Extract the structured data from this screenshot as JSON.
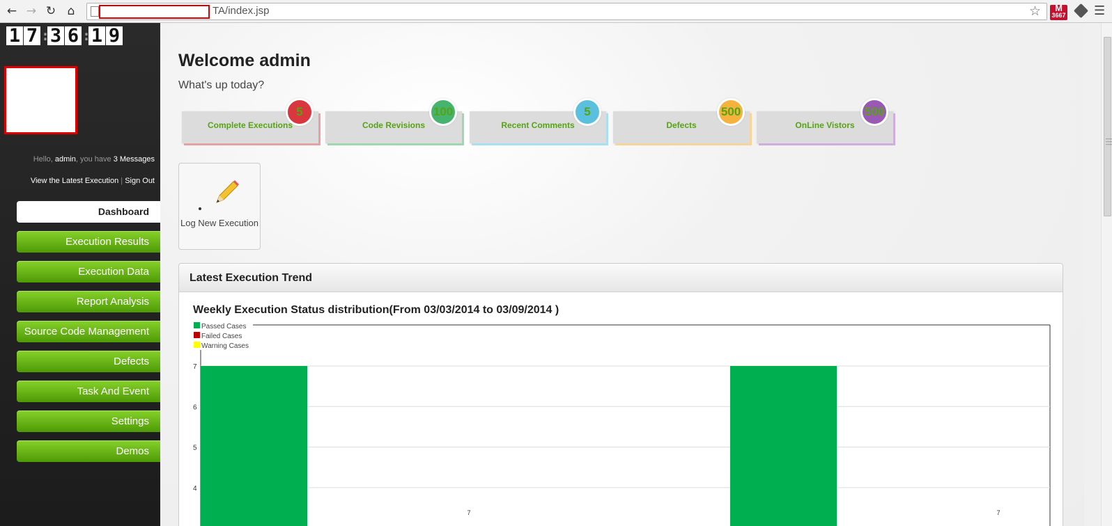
{
  "browser": {
    "url_visible": "TA/index.jsp",
    "ext_badge": "3667"
  },
  "sidebar": {
    "clock": {
      "h1": "1",
      "h2": "7",
      "m1": "3",
      "m2": "6",
      "s1": "1",
      "s2": "9",
      "sep": ":"
    },
    "hello": {
      "prefix": "Hello, ",
      "user": "admin",
      "mid": ", you have ",
      "messages": "3 Messages"
    },
    "links": {
      "latest": "View the Latest Execution",
      "separator": " | ",
      "sign_out": "Sign Out"
    },
    "items": [
      {
        "label": "Dashboard"
      },
      {
        "label": "Execution Results"
      },
      {
        "label": "Execution Data"
      },
      {
        "label": "Report Analysis"
      },
      {
        "label": "Source Code Management"
      },
      {
        "label": "Defects"
      },
      {
        "label": "Task And Event"
      },
      {
        "label": "Settings"
      },
      {
        "label": "Demos"
      }
    ]
  },
  "main": {
    "welcome": "Welcome admin",
    "subtitle": "What's up today?",
    "stats": [
      {
        "label": "Complete Executions",
        "value": "5",
        "color": "#d9363e"
      },
      {
        "label": "Code Revisions",
        "value": "100",
        "color": "#46b46e"
      },
      {
        "label": "Recent Comments",
        "value": "5",
        "color": "#5bc0de"
      },
      {
        "label": "Defects",
        "value": "500",
        "color": "#f5b33e"
      },
      {
        "label": "OnLine Vistors",
        "value": "500",
        "color": "#9b59b6"
      }
    ],
    "shortcut": {
      "label": "Log New Execution"
    },
    "panel": {
      "title": "Latest Execution Trend"
    }
  },
  "chart_data": {
    "type": "bar",
    "title": "Weekly Execution Status distribution(From 03/03/2014 to 03/09/2014 )",
    "legend": [
      "Passed Cases",
      "Failed Cases",
      "Warning Cases"
    ],
    "legend_colors": [
      "#00b050",
      "#c00000",
      "#ffff00"
    ],
    "legend_position": "top-left",
    "yticks": [
      7,
      6,
      5,
      4
    ],
    "visible_yrange": [
      3.3,
      8
    ],
    "grid": true,
    "series": [
      {
        "name": "Passed Cases",
        "color": "#00b050",
        "values": [
          7,
          7
        ]
      }
    ],
    "data_labels": [
      "7",
      "7"
    ]
  }
}
